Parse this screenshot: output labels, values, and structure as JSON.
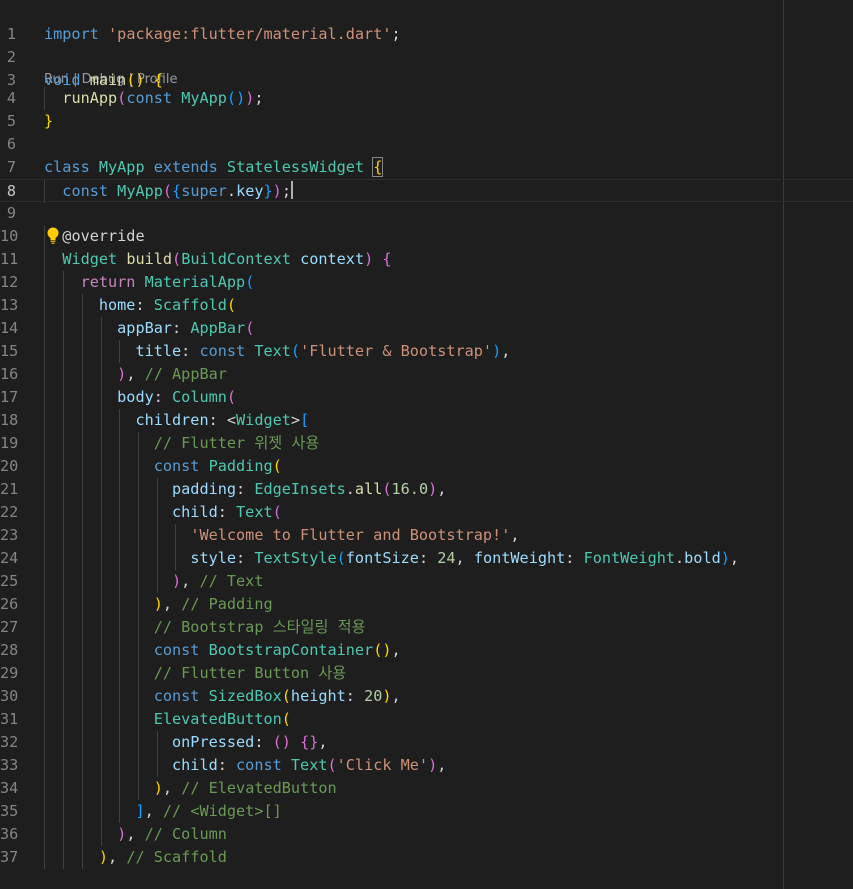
{
  "codelens": {
    "run": "Run",
    "sep1": " | ",
    "debug": "Debug",
    "sep2": " | ",
    "profile": "Profile"
  },
  "icons": {
    "lightbulb": "lightbulb-icon"
  },
  "colors": {
    "background": "#1e1e1e",
    "line_number": "#858585",
    "keyword": "#569cd6",
    "control": "#c586c0",
    "class": "#4ec9b0",
    "function": "#dcdcaa",
    "string": "#ce9178",
    "comment": "#6a9955",
    "property": "#9cdcfe",
    "number": "#b5cea8",
    "bracket_1": "#ffd700",
    "bracket_2": "#da70d6",
    "bracket_3": "#179fff"
  },
  "lines": [
    {
      "n": "1",
      "indent": 0,
      "tokens": [
        [
          "kw",
          "import"
        ],
        [
          "p",
          " "
        ],
        [
          "str",
          "'package:flutter/material.dart'"
        ],
        [
          "p",
          ";"
        ]
      ]
    },
    {
      "n": "2",
      "indent": 0,
      "tokens": []
    },
    {
      "n": "3",
      "indent": 0,
      "tokens": [
        [
          "kw",
          "void"
        ],
        [
          "p",
          " "
        ],
        [
          "fn",
          "main"
        ],
        [
          "b1",
          "()"
        ],
        [
          "p",
          " "
        ],
        [
          "b1",
          "{"
        ]
      ]
    },
    {
      "n": "4",
      "indent": 1,
      "tokens": [
        [
          "fn",
          "runApp"
        ],
        [
          "b2",
          "("
        ],
        [
          "kw",
          "const"
        ],
        [
          "p",
          " "
        ],
        [
          "cls",
          "MyApp"
        ],
        [
          "b3",
          "()"
        ],
        [
          "b2",
          ")"
        ],
        [
          "p",
          ";"
        ]
      ]
    },
    {
      "n": "5",
      "indent": 0,
      "tokens": [
        [
          "b1",
          "}"
        ]
      ]
    },
    {
      "n": "6",
      "indent": 0,
      "tokens": []
    },
    {
      "n": "7",
      "indent": 0,
      "tokens": [
        [
          "kw",
          "class"
        ],
        [
          "p",
          " "
        ],
        [
          "cls",
          "MyApp"
        ],
        [
          "p",
          " "
        ],
        [
          "kw",
          "extends"
        ],
        [
          "p",
          " "
        ],
        [
          "cls",
          "StatelessWidget"
        ],
        [
          "p",
          " "
        ],
        [
          "b1m",
          "{"
        ]
      ]
    },
    {
      "n": "8",
      "indent": 1,
      "tokens": [
        [
          "kw",
          "const"
        ],
        [
          "p",
          " "
        ],
        [
          "cls",
          "MyApp"
        ],
        [
          "b2",
          "("
        ],
        [
          "b3",
          "{"
        ],
        [
          "kw",
          "super"
        ],
        [
          "p",
          "."
        ],
        [
          "var",
          "key"
        ],
        [
          "b3",
          "}"
        ],
        [
          "b2",
          ")"
        ],
        [
          "p",
          ";"
        ],
        [
          "caret",
          ""
        ]
      ]
    },
    {
      "n": "9",
      "indent": 0,
      "tokens": []
    },
    {
      "n": "10",
      "indent": 1,
      "tokens": [
        [
          "p",
          "@override"
        ]
      ]
    },
    {
      "n": "11",
      "indent": 1,
      "tokens": [
        [
          "cls",
          "Widget"
        ],
        [
          "p",
          " "
        ],
        [
          "fn",
          "build"
        ],
        [
          "b2",
          "("
        ],
        [
          "cls",
          "BuildContext"
        ],
        [
          "p",
          " "
        ],
        [
          "var",
          "context"
        ],
        [
          "b2",
          ")"
        ],
        [
          "p",
          " "
        ],
        [
          "b2",
          "{"
        ]
      ]
    },
    {
      "n": "12",
      "indent": 2,
      "tokens": [
        [
          "ctl",
          "return"
        ],
        [
          "p",
          " "
        ],
        [
          "cls",
          "MaterialApp"
        ],
        [
          "b3",
          "("
        ]
      ]
    },
    {
      "n": "13",
      "indent": 3,
      "tokens": [
        [
          "var",
          "home"
        ],
        [
          "p",
          ": "
        ],
        [
          "cls",
          "Scaffold"
        ],
        [
          "b1",
          "("
        ]
      ]
    },
    {
      "n": "14",
      "indent": 4,
      "tokens": [
        [
          "var",
          "appBar"
        ],
        [
          "p",
          ": "
        ],
        [
          "cls",
          "AppBar"
        ],
        [
          "b2",
          "("
        ]
      ]
    },
    {
      "n": "15",
      "indent": 5,
      "tokens": [
        [
          "var",
          "title"
        ],
        [
          "p",
          ": "
        ],
        [
          "kw",
          "const"
        ],
        [
          "p",
          " "
        ],
        [
          "cls",
          "Text"
        ],
        [
          "b3",
          "("
        ],
        [
          "str",
          "'Flutter & Bootstrap'"
        ],
        [
          "b3",
          ")"
        ],
        [
          "p",
          ","
        ]
      ]
    },
    {
      "n": "16",
      "indent": 4,
      "tokens": [
        [
          "b2",
          ")"
        ],
        [
          "p",
          ", "
        ],
        [
          "com",
          "// AppBar"
        ]
      ]
    },
    {
      "n": "17",
      "indent": 4,
      "tokens": [
        [
          "var",
          "body"
        ],
        [
          "p",
          ": "
        ],
        [
          "cls",
          "Column"
        ],
        [
          "b2",
          "("
        ]
      ]
    },
    {
      "n": "18",
      "indent": 5,
      "tokens": [
        [
          "var",
          "children"
        ],
        [
          "p",
          ": <"
        ],
        [
          "cls",
          "Widget"
        ],
        [
          "p",
          ">"
        ],
        [
          "b3",
          "["
        ]
      ]
    },
    {
      "n": "19",
      "indent": 6,
      "tokens": [
        [
          "com",
          "// Flutter 위젯 사용"
        ]
      ]
    },
    {
      "n": "20",
      "indent": 6,
      "tokens": [
        [
          "kw",
          "const"
        ],
        [
          "p",
          " "
        ],
        [
          "cls",
          "Padding"
        ],
        [
          "b1",
          "("
        ]
      ]
    },
    {
      "n": "21",
      "indent": 7,
      "tokens": [
        [
          "var",
          "padding"
        ],
        [
          "p",
          ": "
        ],
        [
          "cls",
          "EdgeInsets"
        ],
        [
          "p",
          "."
        ],
        [
          "fn",
          "all"
        ],
        [
          "b2",
          "("
        ],
        [
          "num",
          "16.0"
        ],
        [
          "b2",
          ")"
        ],
        [
          "p",
          ","
        ]
      ]
    },
    {
      "n": "22",
      "indent": 7,
      "tokens": [
        [
          "var",
          "child"
        ],
        [
          "p",
          ": "
        ],
        [
          "cls",
          "Text"
        ],
        [
          "b2",
          "("
        ]
      ]
    },
    {
      "n": "23",
      "indent": 8,
      "tokens": [
        [
          "str",
          "'Welcome to Flutter and Bootstrap!'"
        ],
        [
          "p",
          ","
        ]
      ]
    },
    {
      "n": "24",
      "indent": 8,
      "tokens": [
        [
          "var",
          "style"
        ],
        [
          "p",
          ": "
        ],
        [
          "cls",
          "TextStyle"
        ],
        [
          "b3",
          "("
        ],
        [
          "var",
          "fontSize"
        ],
        [
          "p",
          ": "
        ],
        [
          "num",
          "24"
        ],
        [
          "p",
          ", "
        ],
        [
          "var",
          "fontWeight"
        ],
        [
          "p",
          ": "
        ],
        [
          "cls",
          "FontWeight"
        ],
        [
          "p",
          "."
        ],
        [
          "var",
          "bold"
        ],
        [
          "b3",
          ")"
        ],
        [
          "p",
          ","
        ]
      ]
    },
    {
      "n": "25",
      "indent": 7,
      "tokens": [
        [
          "b2",
          ")"
        ],
        [
          "p",
          ", "
        ],
        [
          "com",
          "// Text"
        ]
      ]
    },
    {
      "n": "26",
      "indent": 6,
      "tokens": [
        [
          "b1",
          ")"
        ],
        [
          "p",
          ", "
        ],
        [
          "com",
          "// Padding"
        ]
      ]
    },
    {
      "n": "27",
      "indent": 6,
      "tokens": [
        [
          "com",
          "// Bootstrap 스타일링 적용"
        ]
      ]
    },
    {
      "n": "28",
      "indent": 6,
      "tokens": [
        [
          "kw",
          "const"
        ],
        [
          "p",
          " "
        ],
        [
          "cls",
          "BootstrapContainer"
        ],
        [
          "b1",
          "()"
        ],
        [
          "p",
          ","
        ]
      ]
    },
    {
      "n": "29",
      "indent": 6,
      "tokens": [
        [
          "com",
          "// Flutter Button 사용"
        ]
      ]
    },
    {
      "n": "30",
      "indent": 6,
      "tokens": [
        [
          "kw",
          "const"
        ],
        [
          "p",
          " "
        ],
        [
          "cls",
          "SizedBox"
        ],
        [
          "b1",
          "("
        ],
        [
          "var",
          "height"
        ],
        [
          "p",
          ": "
        ],
        [
          "num",
          "20"
        ],
        [
          "b1",
          ")"
        ],
        [
          "p",
          ","
        ]
      ]
    },
    {
      "n": "31",
      "indent": 6,
      "tokens": [
        [
          "cls",
          "ElevatedButton"
        ],
        [
          "b1",
          "("
        ]
      ]
    },
    {
      "n": "32",
      "indent": 7,
      "tokens": [
        [
          "var",
          "onPressed"
        ],
        [
          "p",
          ": "
        ],
        [
          "b2",
          "()"
        ],
        [
          "p",
          " "
        ],
        [
          "b2",
          "{}"
        ],
        [
          "p",
          ","
        ]
      ]
    },
    {
      "n": "33",
      "indent": 7,
      "tokens": [
        [
          "var",
          "child"
        ],
        [
          "p",
          ": "
        ],
        [
          "kw",
          "const"
        ],
        [
          "p",
          " "
        ],
        [
          "cls",
          "Text"
        ],
        [
          "b2",
          "("
        ],
        [
          "str",
          "'Click Me'"
        ],
        [
          "b2",
          ")"
        ],
        [
          "p",
          ","
        ]
      ]
    },
    {
      "n": "34",
      "indent": 6,
      "tokens": [
        [
          "b1",
          ")"
        ],
        [
          "p",
          ", "
        ],
        [
          "com",
          "// ElevatedButton"
        ]
      ]
    },
    {
      "n": "35",
      "indent": 5,
      "tokens": [
        [
          "b3",
          "]"
        ],
        [
          "p",
          ", "
        ],
        [
          "com",
          "// <Widget>[]"
        ]
      ]
    },
    {
      "n": "36",
      "indent": 4,
      "tokens": [
        [
          "b2",
          ")"
        ],
        [
          "p",
          ", "
        ],
        [
          "com",
          "// Column"
        ]
      ]
    },
    {
      "n": "37",
      "indent": 3,
      "tokens": [
        [
          "b1",
          ")"
        ],
        [
          "p",
          ", "
        ],
        [
          "com",
          "// Scaffold"
        ]
      ]
    }
  ]
}
